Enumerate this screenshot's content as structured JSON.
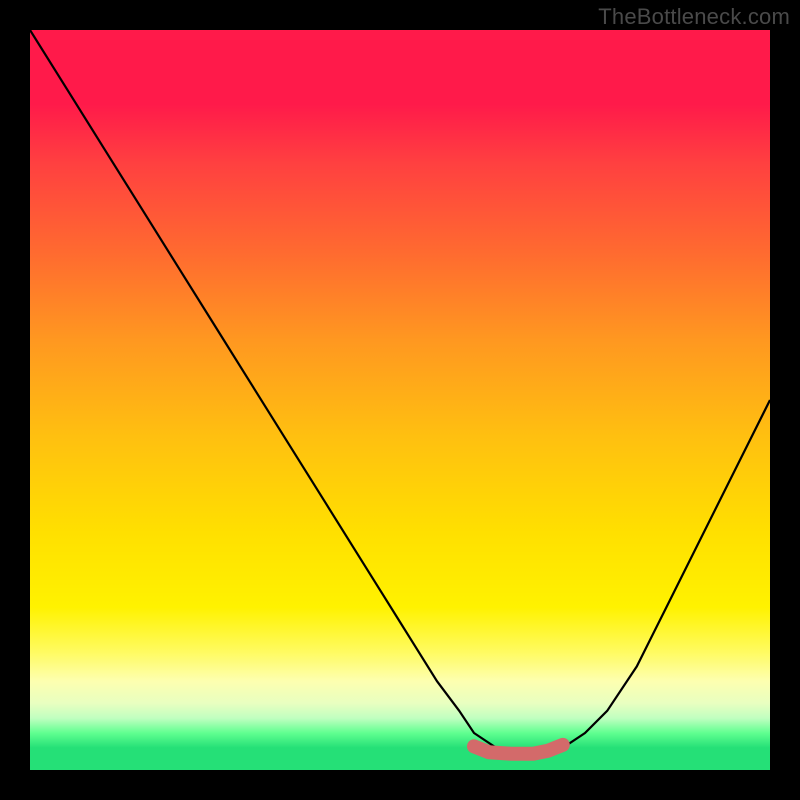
{
  "watermark": "TheBottleneck.com",
  "chart_data": {
    "type": "line",
    "title": "",
    "xlabel": "",
    "ylabel": "",
    "xlim": [
      0,
      100
    ],
    "ylim": [
      0,
      100
    ],
    "grid": false,
    "series": [
      {
        "name": "bottleneck-curve",
        "x": [
          0,
          5,
          10,
          15,
          20,
          25,
          30,
          35,
          40,
          45,
          50,
          55,
          58,
          60,
          63,
          66,
          68,
          70,
          72,
          75,
          78,
          82,
          86,
          90,
          95,
          100
        ],
        "y": [
          100,
          92,
          84,
          76,
          68,
          60,
          52,
          44,
          36,
          28,
          20,
          12,
          8,
          5,
          3,
          2,
          2,
          2,
          3,
          5,
          8,
          14,
          22,
          30,
          40,
          50
        ],
        "color": "#000000"
      },
      {
        "name": "optimal-marker",
        "x": [
          60,
          62,
          65,
          68,
          70,
          72
        ],
        "y": [
          3.2,
          2.4,
          2.2,
          2.2,
          2.6,
          3.4
        ],
        "color": "#d36a6a"
      }
    ]
  }
}
